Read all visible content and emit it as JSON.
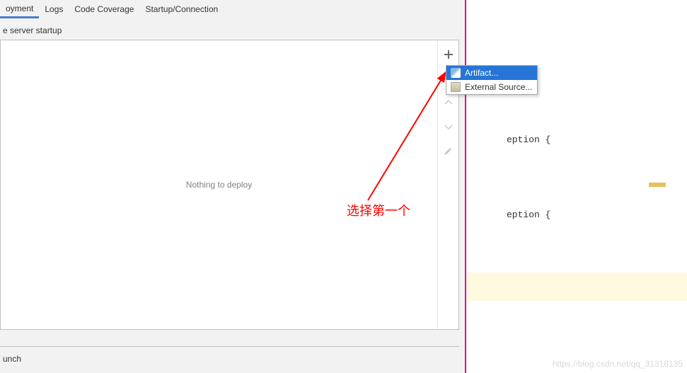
{
  "tabs": {
    "deployment": "oyment",
    "logs": "Logs",
    "coverage": "Code Coverage",
    "startup": "Startup/Connection"
  },
  "section_label": "e server startup",
  "deploy_empty": "Nothing to deploy",
  "bottom_label": "unch",
  "popup": {
    "artifact": "Artifact...",
    "external": "External Source..."
  },
  "annotation_text": "选择第一个",
  "code": {
    "line1": "eption {",
    "line2": "eption {"
  },
  "watermark_text": "https://blog.csdn.net/qq_31318135"
}
